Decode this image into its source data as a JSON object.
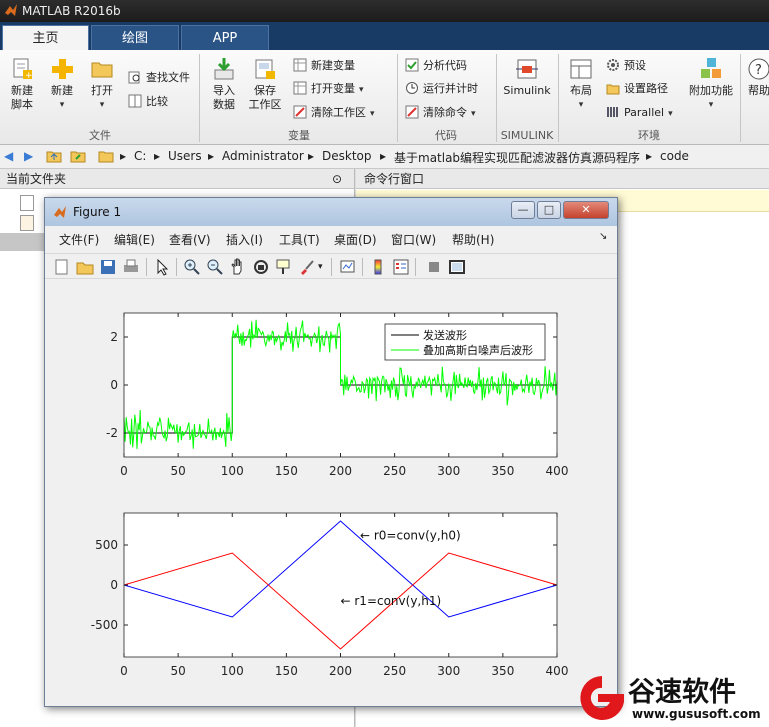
{
  "window": {
    "title": "MATLAB R2016b"
  },
  "tabs": [
    {
      "label": "主页",
      "active": true
    },
    {
      "label": "绘图",
      "active": false
    },
    {
      "label": "APP",
      "active": false
    }
  ],
  "ribbon": {
    "file": {
      "group_label": "文件",
      "new_script": "新建\n脚本",
      "new": "新建",
      "open": "打开",
      "find_files": "查找文件",
      "compare": "比较"
    },
    "variable": {
      "group_label": "变量",
      "import_data": "导入\n数据",
      "save_workspace": "保存\n工作区",
      "new_variable": "新建变量",
      "open_variable": "打开变量",
      "clear_workspace": "清除工作区"
    },
    "code": {
      "group_label": "代码",
      "analyze_code": "分析代码",
      "run_and_time": "运行并计时",
      "clear_commands": "清除命令"
    },
    "simulink": {
      "group_label": "SIMULINK",
      "simulink": "Simulink"
    },
    "environment": {
      "group_label": "环境",
      "layout": "布局",
      "preferences": "预设",
      "set_path": "设置路径",
      "parallel": "Parallel",
      "addons": "附加功能",
      "help": "帮助"
    }
  },
  "address": {
    "crumbs": [
      "C:",
      "Users",
      "Administrator",
      "Desktop",
      "基于matlab编程实现匹配滤波器仿真源码程序",
      "code"
    ]
  },
  "panels": {
    "current_folder": "当前文件夹",
    "command_window": "命令行窗口"
  },
  "figure": {
    "title": "Figure 1",
    "menu": [
      "文件(F)",
      "编辑(E)",
      "查看(V)",
      "插入(I)",
      "工具(T)",
      "桌面(D)",
      "窗口(W)",
      "帮助(H)"
    ],
    "toolbar_icons": [
      "new-figure-icon",
      "open-icon",
      "save-icon",
      "print-icon",
      "pointer-icon",
      "zoom-in-icon",
      "zoom-out-icon",
      "pan-icon",
      "rotate-icon",
      "data-cursor-icon",
      "brush-icon",
      "link-plot-icon",
      "colorbar-icon",
      "legend-icon",
      "hide-plot-tools-icon",
      "show-plot-tools-icon"
    ]
  },
  "chart_data": [
    {
      "type": "line",
      "xlim": [
        0,
        400
      ],
      "ylim": [
        -3,
        3
      ],
      "xticks": [
        0,
        50,
        100,
        150,
        200,
        250,
        300,
        350,
        400
      ],
      "yticks": [
        -2,
        0,
        2
      ],
      "legend_position": "top-right",
      "series": [
        {
          "name": "发送波形",
          "color": "#000000",
          "x": [
            0,
            100,
            100,
            200,
            200,
            400
          ],
          "y": [
            -2,
            -2,
            2,
            2,
            0,
            0
          ]
        },
        {
          "name": "叠加高斯白噪声后波形",
          "color": "#00ff00",
          "noise_std": 0.3,
          "segments": [
            {
              "x_range": [
                0,
                100
              ],
              "mean": -2
            },
            {
              "x_range": [
                100,
                200
              ],
              "mean": 2
            },
            {
              "x_range": [
                200,
                400
              ],
              "mean": 0
            }
          ]
        }
      ]
    },
    {
      "type": "line",
      "xlim": [
        0,
        400
      ],
      "ylim": [
        -900,
        900
      ],
      "xticks": [
        0,
        50,
        100,
        150,
        200,
        250,
        300,
        350,
        400
      ],
      "yticks": [
        -500,
        0,
        500
      ],
      "annotations": [
        {
          "text": "← r0=conv(y,h0)",
          "x": 218,
          "y": 620
        },
        {
          "text": "← r1=conv(y,h1)",
          "x": 200,
          "y": -200
        }
      ],
      "series": [
        {
          "name": "r0=conv(y,h0)",
          "color": "#0000ff",
          "x": [
            0,
            100,
            200,
            300,
            400
          ],
          "y": [
            0,
            -400,
            800,
            -400,
            0
          ]
        },
        {
          "name": "r1=conv(y,h1)",
          "color": "#ff0000",
          "x": [
            0,
            100,
            200,
            300,
            400
          ],
          "y": [
            0,
            400,
            -800,
            400,
            0
          ]
        }
      ]
    }
  ],
  "watermark": {
    "name": "谷速软件",
    "url": "www.gususoft.com"
  }
}
